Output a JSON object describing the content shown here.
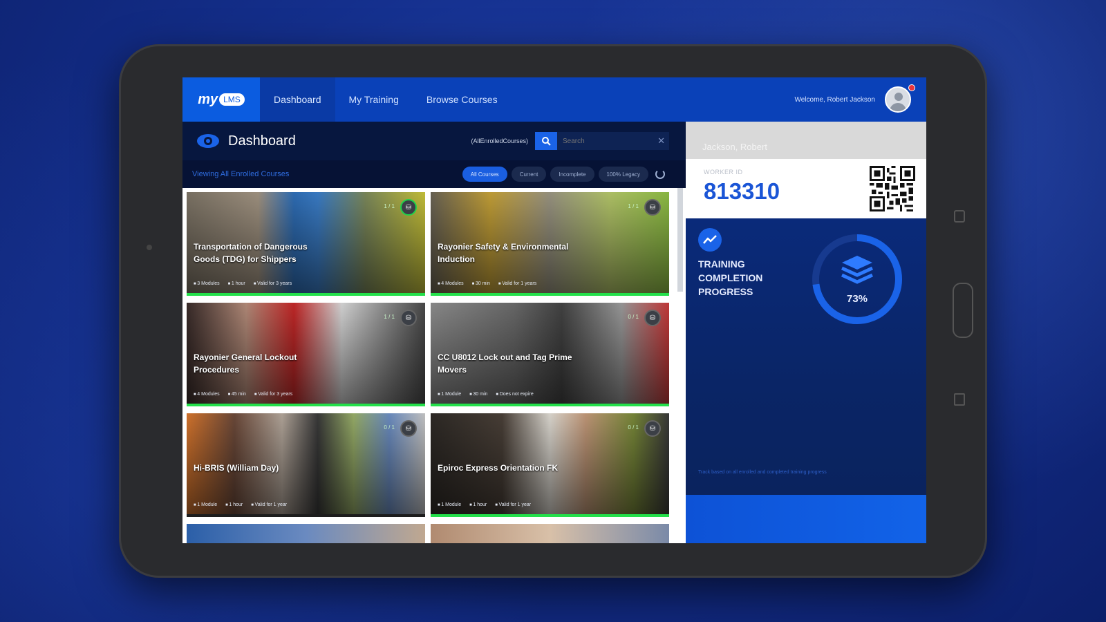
{
  "nav": {
    "logo_text": "my",
    "logo_badge": "LMS",
    "items": [
      {
        "label": "Dashboard",
        "active": true
      },
      {
        "label": "My Training",
        "active": false
      },
      {
        "label": "Browse Courses",
        "active": false
      }
    ],
    "welcome": "Welcome, Robert Jackson"
  },
  "dashboard": {
    "title": "Dashboard",
    "search_label": "(AllEnrolledCourses)",
    "search_placeholder": "Search",
    "viewing": "Viewing All Enrolled Courses",
    "filters": [
      {
        "label": "All Courses",
        "active": true
      },
      {
        "label": "Current",
        "active": false
      },
      {
        "label": "Incomplete",
        "active": false
      },
      {
        "label": "100% Legacy",
        "active": false
      }
    ]
  },
  "courses": [
    {
      "title": "Transportation of Dangerous Goods (TDG) for Shippers",
      "count": "1 / 1",
      "meta": [
        "3 Modules",
        "1 hour",
        "Valid for 3 years"
      ],
      "complete": true
    },
    {
      "title": "Rayonier Safety & Environmental Induction",
      "count": "1 / 1",
      "meta": [
        "4 Modules",
        "30 min",
        "Valid for 1 years"
      ],
      "complete": true
    },
    {
      "title": "Rayonier General Lockout Procedures",
      "count": "1 / 1",
      "meta": [
        "4 Modules",
        "45 min",
        "Valid for 3 years"
      ],
      "complete": true
    },
    {
      "title": "CC U8012 Lock out and Tag Prime Movers",
      "count": "0 / 1",
      "meta": [
        "1 Module",
        "30 min",
        "Does not expire"
      ],
      "complete": true
    },
    {
      "title": "Hi-BRIS (William Day)",
      "count": "0 / 1",
      "meta": [
        "1 Module",
        "1 hour",
        "Valid for 1 year"
      ],
      "complete": false
    },
    {
      "title": "Epiroc Express Orientation FK",
      "count": "0 / 1",
      "meta": [
        "1 Module",
        "1 hour",
        "Valid for 1 year"
      ],
      "complete": true
    }
  ],
  "profile": {
    "name": "Jackson, Robert",
    "id_label": "WORKER ID",
    "id_value": "813310"
  },
  "progress": {
    "label": "Training Completion Progress",
    "percent": 73,
    "percent_text": "73%",
    "note": "Track based on all enrolled and completed training progress"
  },
  "colors": {
    "accent": "#1a63e8",
    "complete": "#23e04a",
    "nav": "#0a41b8",
    "panel": "#08163d"
  }
}
